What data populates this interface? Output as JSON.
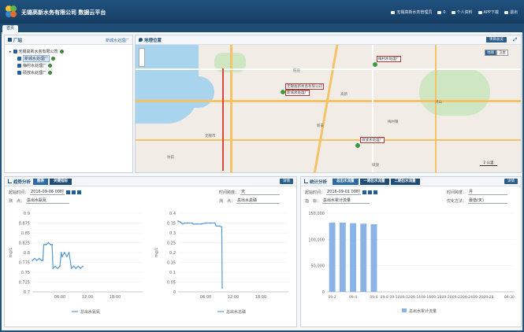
{
  "header": {
    "title": "无锡高新水务有限公司 数据云平台",
    "links": [
      "无锡高新水务管理员",
      "0",
      "个人资料",
      "APP下载",
      "退出"
    ]
  },
  "tabs": [
    "首页"
  ],
  "factory_panel": {
    "title": "厂站",
    "selected": "新城水处理厂",
    "tree": {
      "root": "无锡高新水务有限公司",
      "children": [
        "新城水处理厂",
        "梅村水处理厂",
        "硕放水处理厂"
      ]
    }
  },
  "map_panel": {
    "title": "地理位置",
    "button": "项目总览",
    "map_type": [
      "地图",
      "卫星"
    ],
    "scale": "2 公里",
    "markers": [
      "梅村水处理厂",
      "新城水处理厂",
      "无锡高新水务有限公司",
      "硕放水处理厂"
    ],
    "place_labels": [
      "无锡市",
      "梅村镇",
      "硕放",
      "新安",
      "鸿山",
      "坊前",
      "旺庄",
      "高新"
    ]
  },
  "trend_panel": {
    "title": "趋势分析",
    "tabs": [
      "图表",
      "关键指标"
    ],
    "detail_button": "详情",
    "start_label": "起始时间：",
    "start_value": "2016-09-06 00时",
    "dim_label": "时间跨度：",
    "dim_value": "天",
    "point_label": "测　点：",
    "point_left": "总出水氨氮",
    "point_right": "总出水总磷"
  },
  "stats_panel": {
    "title": "统计分析",
    "tabs": [
      "总出水流量",
      "一期出水流量",
      "二期出水流量"
    ],
    "detail_button": "详情",
    "start_label": "起始时间：",
    "start_value": "2016-09-01 00时",
    "dim_label": "时间跨度：",
    "dim_value": "月",
    "target_label": "指　标：",
    "target_value": "总出水累计流量",
    "opt_label": "优化方法：",
    "opt_value": "最值(天)"
  },
  "chart_data": [
    {
      "type": "line",
      "title": "",
      "ylabel": "mg/L",
      "ylim": [
        0.7,
        0.9
      ],
      "yticks": [
        "0.9",
        "0.875",
        "0.85",
        "0.825",
        "0.8",
        "0.775",
        "0.75",
        "0.725",
        "0.7"
      ],
      "xticks": [
        "06:00",
        "12:00",
        "18:00"
      ],
      "x_range_hours": [
        0,
        24
      ],
      "series": [
        {
          "name": "总出水氨氮",
          "x": [
            0,
            0.5,
            1,
            1.5,
            2,
            2.3,
            2.5,
            3,
            3.5,
            4,
            4.3,
            4.5,
            5,
            5.5,
            6,
            6.3,
            6.5,
            7,
            7.5,
            8,
            8.5,
            9,
            9.5,
            10,
            10.5,
            11
          ],
          "values": [
            0.78,
            0.785,
            0.78,
            0.785,
            0.78,
            0.78,
            0.82,
            0.82,
            0.825,
            0.82,
            0.82,
            0.76,
            0.765,
            0.76,
            0.765,
            0.8,
            0.79,
            0.8,
            0.79,
            0.8,
            0.76,
            0.765,
            0.76,
            0.765,
            0.76,
            0.765
          ]
        }
      ]
    },
    {
      "type": "line",
      "title": "",
      "ylabel": "mg/L",
      "ylim": [
        0,
        0.4
      ],
      "yticks": [
        "0.4",
        "0.35",
        "0.3",
        "0.25",
        "0.2",
        "0.15",
        "0.1",
        "0.05",
        "0"
      ],
      "xticks": [
        "06:00",
        "12:00",
        "18:00"
      ],
      "x_range_hours": [
        0,
        24
      ],
      "series": [
        {
          "name": "总出水总磷",
          "x": [
            0,
            0.5,
            1,
            1.5,
            2,
            3,
            3.3,
            4,
            5,
            6,
            7,
            8,
            8.3,
            9,
            9.5,
            9.6
          ],
          "values": [
            0.36,
            0.355,
            0.345,
            0.35,
            0.35,
            0.35,
            0.345,
            0.345,
            0.345,
            0.35,
            0.35,
            0.35,
            0.335,
            0.335,
            0.33,
            0.02
          ]
        }
      ]
    },
    {
      "type": "bar",
      "title": "",
      "ylim": [
        0,
        150000
      ],
      "yticks": [
        "150,000",
        "100,000",
        "50,000",
        "0"
      ],
      "categories": [
        "09-2",
        "09-3",
        "09-4",
        "09-5",
        "09-6",
        "09-8",
        "09-10",
        "09-12",
        "09-14",
        "09-16",
        "09-18",
        "09-20",
        "09-22",
        "09-24",
        "09-26",
        "09-28",
        "09-29",
        "09-30"
      ],
      "xticks": [
        "09-2",
        "09-4",
        "09-6",
        "09-8",
        "09-10",
        "09-12",
        "09-14",
        "09-16",
        "09-18",
        "09-20",
        "09-22",
        "09-24",
        "09-26",
        "09-28",
        "09-30"
      ],
      "series": [
        {
          "name": "总出水累计流量",
          "values": [
            132000,
            132000,
            131000,
            130000,
            129000,
            0,
            0,
            0,
            0,
            0,
            0,
            0,
            0,
            0,
            0,
            0,
            0,
            0
          ]
        }
      ]
    }
  ],
  "colors": {
    "header": "#1f4c75",
    "line": "#5b9bd5",
    "bar": "#8ab4e8",
    "marker": "#3f9a3f"
  }
}
